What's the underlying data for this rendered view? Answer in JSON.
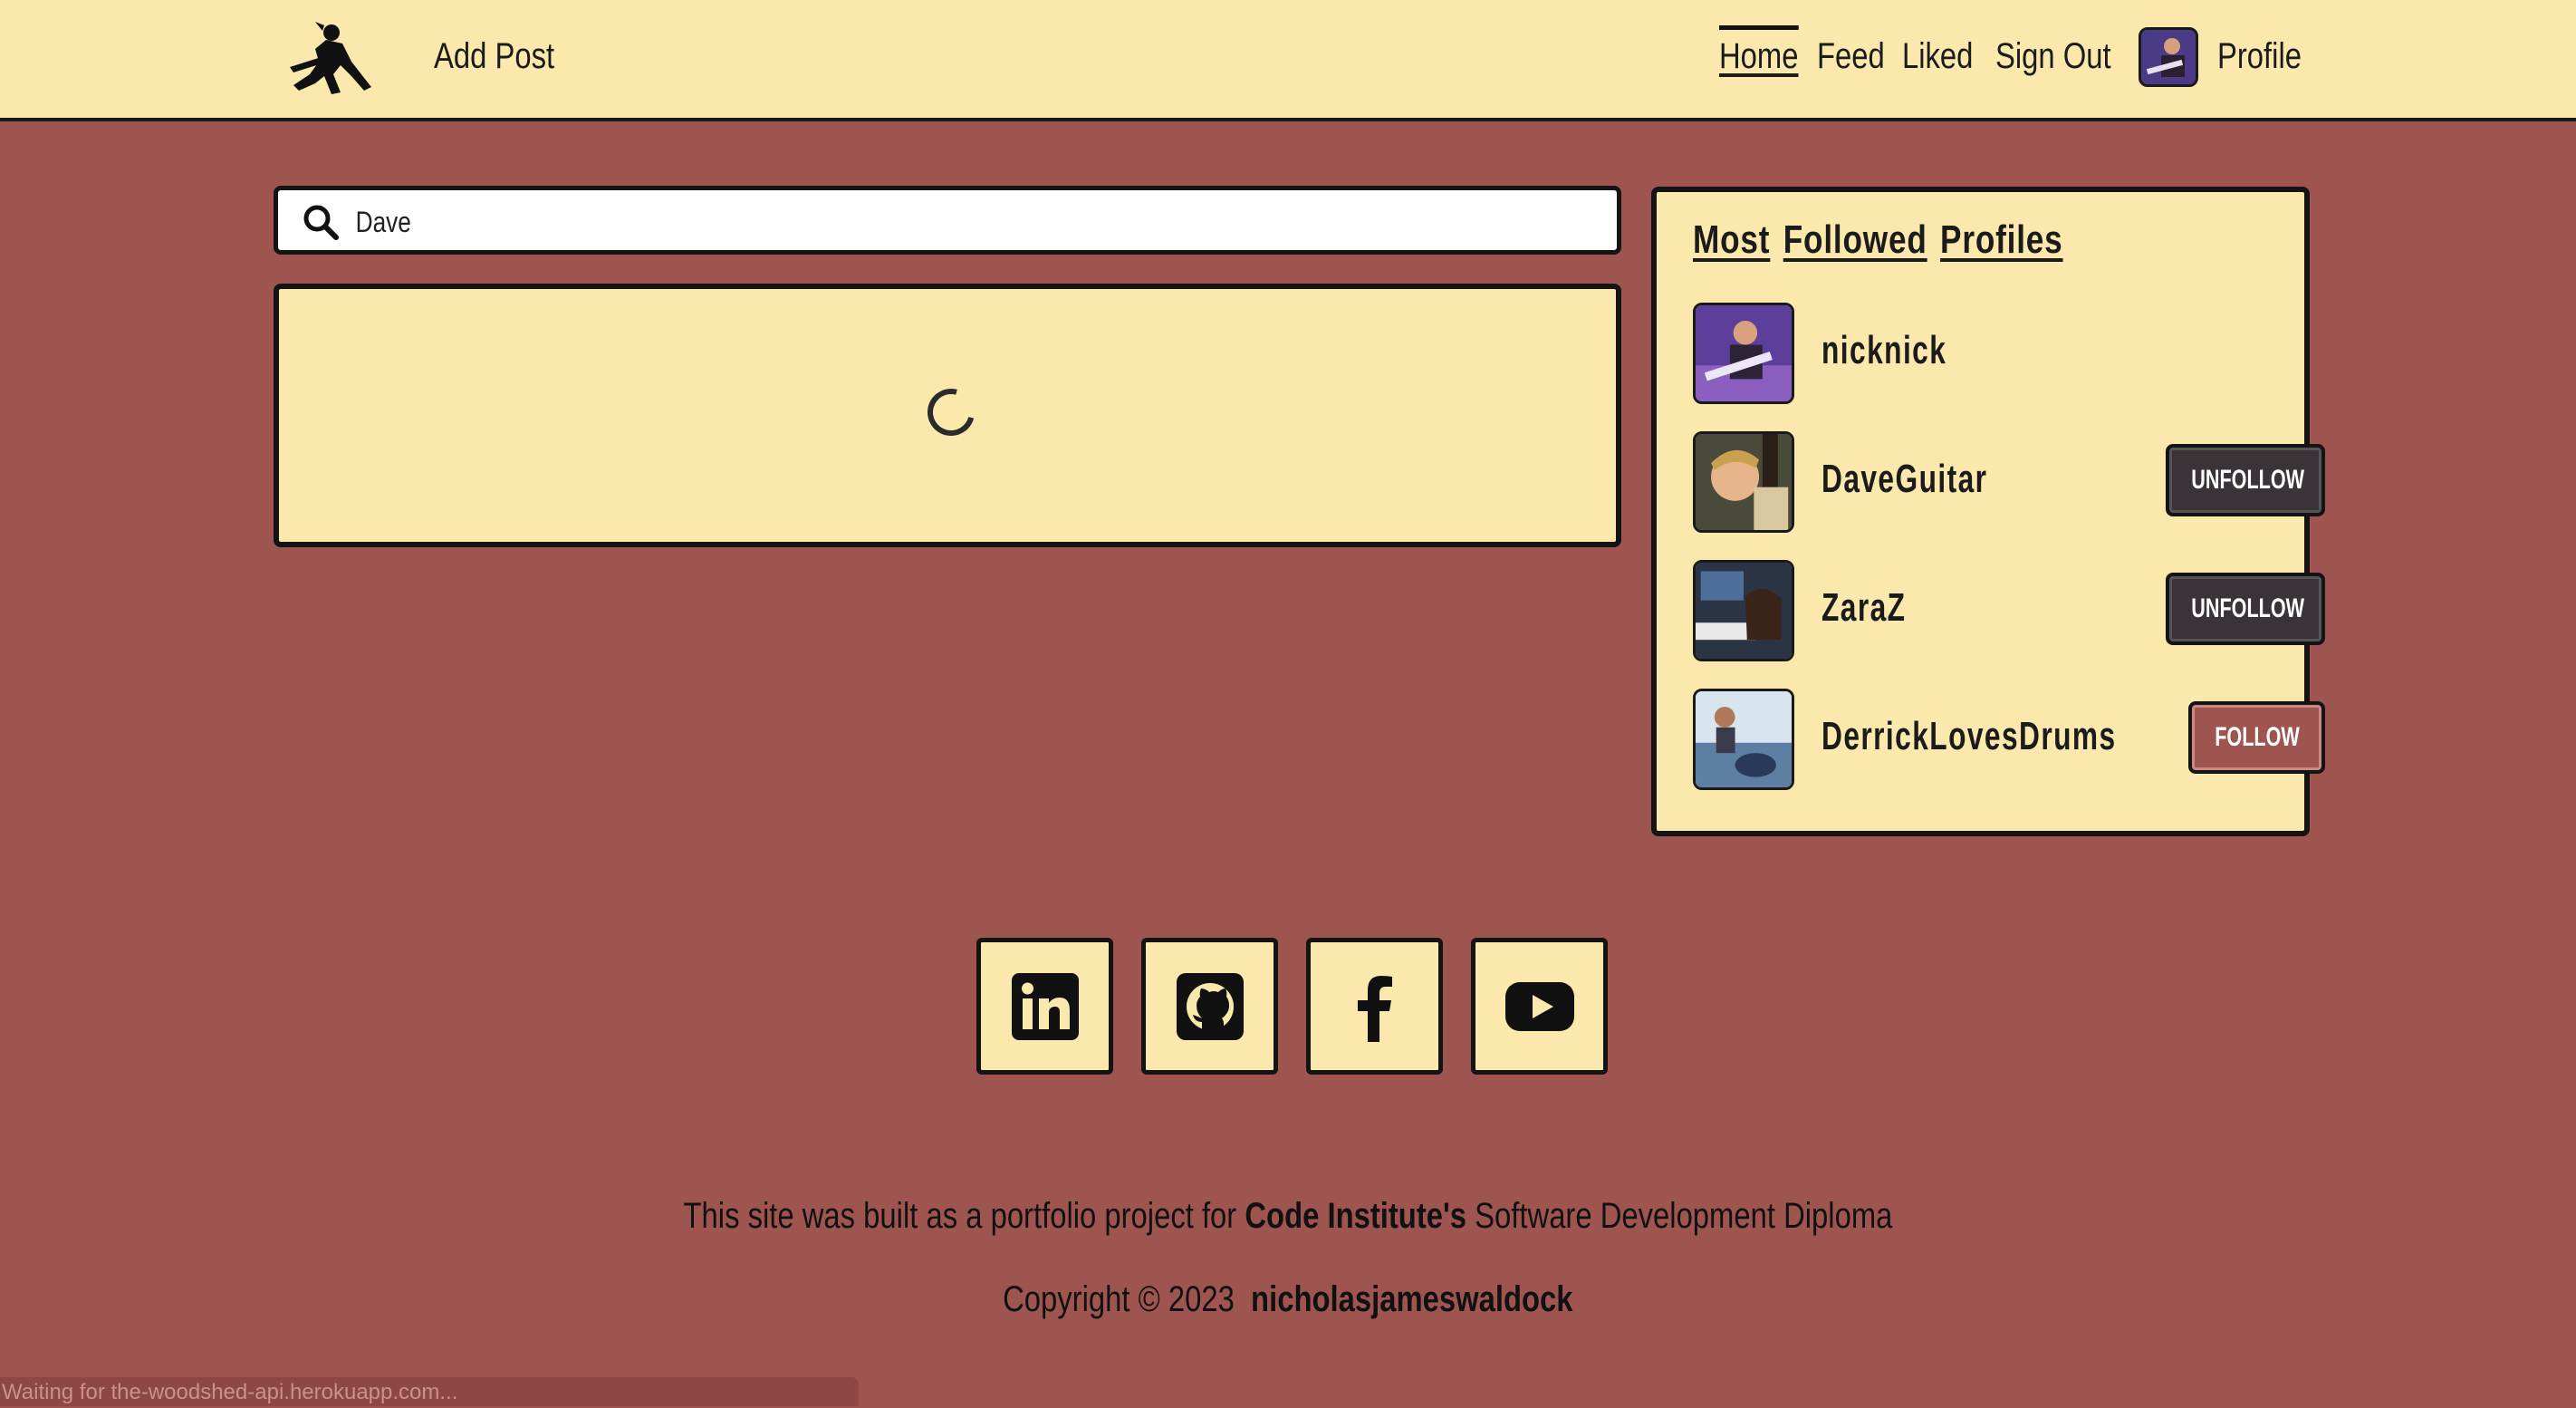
{
  "navbar": {
    "add_post": "Add Post",
    "links": [
      "Home",
      "Feed",
      "Liked",
      "Sign Out"
    ],
    "profile": "Profile"
  },
  "search": {
    "value": "Dave"
  },
  "sidebar": {
    "title_words": [
      "Most",
      "Followed",
      "Profiles"
    ],
    "profiles": [
      {
        "name": "nicknick",
        "button": ""
      },
      {
        "name": "DaveGuitar",
        "button": "UNFOLLOW"
      },
      {
        "name": "ZaraZ",
        "button": "UNFOLLOW"
      },
      {
        "name": "DerrickLovesDrums",
        "button": "FOLLOW"
      }
    ]
  },
  "social": [
    "linkedin-icon",
    "github-icon",
    "facebook-icon",
    "youtube-icon"
  ],
  "footer": {
    "line1_pre": "This site was built as a portfolio project for ",
    "line1_bold": "Code Institute's",
    "line1_post": " Software Development Diploma",
    "copyright": "Copyright © 2023",
    "author": "nicholasjameswaldock"
  },
  "status": "Waiting for the-woodshed-api.herokuapp.com..."
}
